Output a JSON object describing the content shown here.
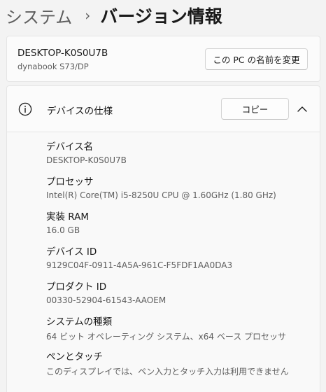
{
  "breadcrumb": {
    "parent": "システム",
    "separator": "›",
    "current": "バージョン情報"
  },
  "device": {
    "name": "DESKTOP-K0S0U7B",
    "model": "dynabook S73/DP",
    "rename_button": "この PC の名前を変更"
  },
  "device_specs": {
    "title": "デバイスの仕様",
    "copy_button": "コピー",
    "items": [
      {
        "label": "デバイス名",
        "value": "DESKTOP-K0S0U7B"
      },
      {
        "label": "プロセッサ",
        "value": "Intel(R) Core(TM) i5-8250U CPU @ 1.60GHz (1.80 GHz)"
      },
      {
        "label": "実装 RAM",
        "value": "16.0 GB"
      },
      {
        "label": "デバイス ID",
        "value": "9129C04F-0911-4A5A-961C-F5FDF1AA0DA3"
      },
      {
        "label": "プロダクト ID",
        "value": "00330-52904-61543-AAOEM"
      },
      {
        "label": "システムの種類",
        "value": "64 ビット オペレーティング システム、x64 ベース プロセッサ"
      },
      {
        "label": "ペンとタッチ",
        "value": "このディスプレイでは、ペン入力とタッチ入力は利用できません"
      }
    ]
  },
  "icons": {
    "info": "info-icon",
    "collapse": "chevron-up-icon"
  }
}
